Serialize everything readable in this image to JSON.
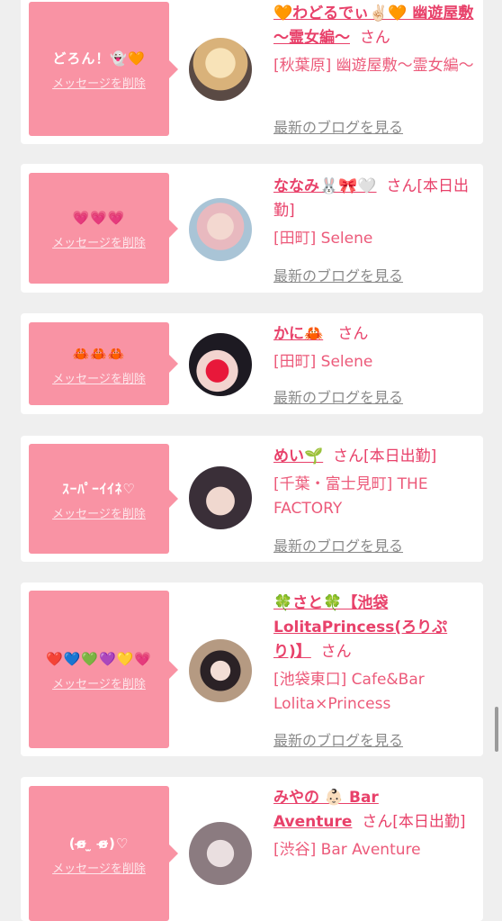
{
  "delete_label": "メッセージを削除",
  "blog_label": "最新のブログを見る",
  "san": "さん",
  "items": [
    {
      "message": "どろん！👻🧡",
      "name": "🧡わどるでぃ✌🏻🧡 幽遊屋敷 〜霊女編〜",
      "suffix": "さん",
      "shop": "[秋葉原] 幽遊屋敷〜霊女編〜"
    },
    {
      "message": "💗💗💗",
      "name": "ななみ🐰🎀🤍",
      "suffix": "さん[本日出勤]",
      "shop": "[田町] Selene"
    },
    {
      "message": "🦀🦀🦀",
      "name": "かに🦀",
      "suffix": "さん",
      "shop": "[田町] Selene"
    },
    {
      "message": "ｽｰﾊﾟｰｲｲﾈ♡",
      "name": "めい🌱",
      "suffix": "さん[本日出勤]",
      "shop": "[千葉・富士見町] THE FACTORY"
    },
    {
      "message": "❤️💙💚💜💛💗",
      "name": "🍀さと🍀【池袋LolitaPrincess(ろりぷり)】",
      "suffix": "さん",
      "shop": "[池袋東口] Cafe&Bar Lolita×Princess"
    },
    {
      "message": "(ɞ̴̶̷ ̫ ɞ̴̶̷)♡",
      "name": "みやの 👶🏻 Bar Aventure",
      "suffix": "さん[本日出勤]",
      "shop": "[渋谷] Bar Aventure"
    }
  ],
  "colors": {
    "bubble": "#f993a4",
    "name": "#e8416a",
    "shop": "#ec5a7a",
    "background": "#efefef"
  }
}
